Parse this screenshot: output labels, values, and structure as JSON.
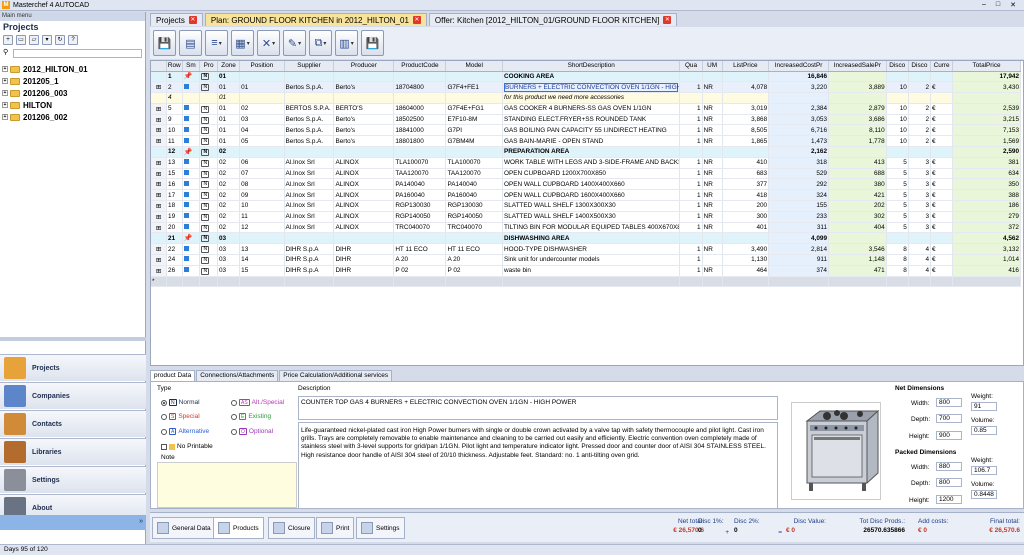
{
  "window": {
    "title": "Masterchef 4 AUTOCAD",
    "btn_min": "–",
    "btn_max": "□",
    "btn_close": "✕"
  },
  "sidebar": {
    "main_menu": "Main menu",
    "heading": "Projects",
    "tree": [
      "2012_HILTON_01",
      "201205_1",
      "201206_003",
      "HILTON",
      "201206_002"
    ],
    "nav": [
      {
        "label": "Projects",
        "icon": "projects-icon",
        "color": "#e8a23a"
      },
      {
        "label": "Companies",
        "icon": "companies-icon",
        "color": "#5c86c9"
      },
      {
        "label": "Contacts",
        "icon": "contacts-icon",
        "color": "#d08a38"
      },
      {
        "label": "Libraries",
        "icon": "libraries-icon",
        "color": "#b36b2e"
      },
      {
        "label": "Settings",
        "icon": "settings-icon",
        "color": "#8a8f99"
      },
      {
        "label": "About",
        "icon": "about-icon",
        "color": "#6a7383"
      }
    ]
  },
  "tabs": [
    {
      "label": "Projects",
      "active": false
    },
    {
      "label": "Plan: GROUND FLOOR KITCHEN in 2012_HILTON_01",
      "active": true
    },
    {
      "label": "Offer: Kitchen [2012_HILTON_01/GROUND FLOOR KITCHEN]",
      "active": false
    }
  ],
  "grid": {
    "columns": [
      "Row",
      "Sm",
      "Pro",
      "Zone",
      "Position",
      "Supplier",
      "Producer",
      "ProductCode",
      "Model",
      "ShortDescription",
      "Qua",
      "UM",
      "ListPrice",
      "IncreasedCostPr",
      "IncreasedSalePr",
      "Disco",
      "Disco",
      "Curre",
      "TotalPrice"
    ],
    "rows": [
      {
        "type": "section",
        "row": "1",
        "zone": "01",
        "desc": "COOKING AREA",
        "cost": "16,846",
        "total": "17,942"
      },
      {
        "type": "item",
        "selected": true,
        "row": "2",
        "zone": "01",
        "pos": "01",
        "sup": "Bertos S.p.A.",
        "prod": "Berto's",
        "code": "18704800",
        "model": "G7F4+FE1",
        "desc": "BURNERS + ELECTRIC CONVECTION OVEN 1/1GN - HIGH POWER",
        "qua": "1",
        "um": "NR",
        "list": "4,078",
        "cost": "3,220",
        "sale": "3,889",
        "d1": "10",
        "d2": "2",
        "cur": "€",
        "total": "3,430"
      },
      {
        "type": "note",
        "row": "4",
        "zone": "01",
        "desc": "for this product we need more accessories"
      },
      {
        "type": "item",
        "row": "5",
        "zone": "01",
        "pos": "02",
        "sup": "BERTOS S.P.A.",
        "prod": "BERTO'S",
        "code": "18604000",
        "model": "G7F4E+FG1",
        "desc": "GAS COOKER 4 BURNERS-SS GAS OVEN 1/1GN",
        "qua": "1",
        "um": "NR",
        "list": "3,019",
        "cost": "2,384",
        "sale": "2,879",
        "d1": "10",
        "d2": "2",
        "cur": "€",
        "total": "2,539"
      },
      {
        "type": "item",
        "row": "9",
        "zone": "01",
        "pos": "03",
        "sup": "Bertos S.p.A.",
        "prod": "Berto's",
        "code": "18502500",
        "model": "E7F10-8M",
        "desc": "STANDING ELECT.FRYER+SS ROUNDED TANK",
        "qua": "1",
        "um": "NR",
        "list": "3,868",
        "cost": "3,053",
        "sale": "3,686",
        "d1": "10",
        "d2": "2",
        "cur": "€",
        "total": "3,215"
      },
      {
        "type": "item",
        "row": "10",
        "zone": "01",
        "pos": "04",
        "sup": "Bertos S.p.A.",
        "prod": "Berto's",
        "code": "18841000",
        "model": "G7PI",
        "desc": "GAS BOILING PAN CAPACITY 55 I.INDIRECT HEATING",
        "qua": "1",
        "um": "NR",
        "list": "8,505",
        "cost": "6,716",
        "sale": "8,110",
        "d1": "10",
        "d2": "2",
        "cur": "€",
        "total": "7,153"
      },
      {
        "type": "item",
        "row": "11",
        "zone": "01",
        "pos": "05",
        "sup": "Bertos S.p.A.",
        "prod": "Berto's",
        "code": "18801800",
        "model": "G7BM4M",
        "desc": "GAS BAIN-MARIE - OPEN STAND",
        "qua": "1",
        "um": "NR",
        "list": "1,865",
        "cost": "1,473",
        "sale": "1,778",
        "d1": "10",
        "d2": "2",
        "cur": "€",
        "total": "1,569"
      },
      {
        "type": "section",
        "row": "12",
        "zone": "02",
        "desc": "PREPARATION AREA",
        "cost": "2,162",
        "total": "2,590"
      },
      {
        "type": "item",
        "row": "13",
        "zone": "02",
        "pos": "06",
        "sup": "Al.Inox Srl",
        "prod": "ALINOX",
        "code": "TLA100070",
        "model": "TLA100070",
        "desc": "WORK TABLE WITH LEGS AND 3-SIDE-FRAME AND BACKSPLASH",
        "qua": "1",
        "um": "NR",
        "list": "410",
        "cost": "318",
        "sale": "413",
        "d1": "5",
        "d2": "3",
        "cur": "€",
        "total": "381"
      },
      {
        "type": "item",
        "row": "15",
        "zone": "02",
        "pos": "07",
        "sup": "Al.Inox Srl",
        "prod": "ALINOX",
        "code": "TAA120070",
        "model": "TAA120070",
        "desc": "OPEN CUPBOARD  1200X700X850",
        "qua": "1",
        "um": "NR",
        "list": "683",
        "cost": "529",
        "sale": "688",
        "d1": "5",
        "d2": "3",
        "cur": "€",
        "total": "634"
      },
      {
        "type": "item",
        "row": "16",
        "zone": "02",
        "pos": "08",
        "sup": "Al.Inox Srl",
        "prod": "ALINOX",
        "code": "PA140040",
        "model": "PA140040",
        "desc": "OPEN WALL CUPBOARD 1400X400X660",
        "qua": "1",
        "um": "NR",
        "list": "377",
        "cost": "292",
        "sale": "380",
        "d1": "5",
        "d2": "3",
        "cur": "€",
        "total": "350"
      },
      {
        "type": "item",
        "row": "17",
        "zone": "02",
        "pos": "09",
        "sup": "Al.Inox Srl",
        "prod": "ALINOX",
        "code": "PA160040",
        "model": "PA160040",
        "desc": "OPEN WALL CUPBOARD 1600X400X660",
        "qua": "1",
        "um": "NR",
        "list": "418",
        "cost": "324",
        "sale": "421",
        "d1": "5",
        "d2": "3",
        "cur": "€",
        "total": "388"
      },
      {
        "type": "item",
        "row": "18",
        "zone": "02",
        "pos": "10",
        "sup": "Al.Inox Srl",
        "prod": "ALINOX",
        "code": "RGP130030",
        "model": "RGP130030",
        "desc": "SLATTED WALL SHELF  1300X300X30",
        "qua": "1",
        "um": "NR",
        "list": "200",
        "cost": "155",
        "sale": "202",
        "d1": "5",
        "d2": "3",
        "cur": "€",
        "total": "186"
      },
      {
        "type": "item",
        "row": "19",
        "zone": "02",
        "pos": "11",
        "sup": "Al.Inox Srl",
        "prod": "ALINOX",
        "code": "RGP140050",
        "model": "RGP140050",
        "desc": "SLATTED WALL SHELF  1400X500X30",
        "qua": "1",
        "um": "NR",
        "list": "300",
        "cost": "233",
        "sale": "302",
        "d1": "5",
        "d2": "3",
        "cur": "€",
        "total": "279"
      },
      {
        "type": "item",
        "row": "20",
        "zone": "02",
        "pos": "12",
        "sup": "Al.Inox Srl",
        "prod": "ALINOX",
        "code": "TRC040070",
        "model": "TRC040070",
        "desc": "TILTING BIN FOR MODULAR EQUIPED TABLES 400X670X810",
        "qua": "1",
        "um": "NR",
        "list": "401",
        "cost": "311",
        "sale": "404",
        "d1": "5",
        "d2": "3",
        "cur": "€",
        "total": "372"
      },
      {
        "type": "section",
        "row": "21",
        "zone": "03",
        "desc": "DISHWASHING AREA",
        "cost": "4,099",
        "total": "4,562"
      },
      {
        "type": "item",
        "row": "22",
        "zone": "03",
        "pos": "13",
        "sup": "DIHR S.p.A",
        "prod": "DIHR",
        "code": "HT 11 ECO",
        "model": "HT 11 ECO",
        "desc": "HOOD-TYPE DISHWASHER",
        "qua": "1",
        "um": "NR",
        "list": "3,490",
        "cost": "2,814",
        "sale": "3,546",
        "d1": "8",
        "d2": "4",
        "cur": "€",
        "total": "3,132"
      },
      {
        "type": "item",
        "row": "24",
        "zone": "03",
        "pos": "14",
        "sup": "DIHR S.p.A",
        "prod": "DIHR",
        "code": "A 20",
        "model": "A 20",
        "desc": "Sink unit for undercounter models",
        "qua": "1",
        "um": "",
        "list": "1,130",
        "cost": "911",
        "sale": "1,148",
        "d1": "8",
        "d2": "4",
        "cur": "€",
        "total": "1,014"
      },
      {
        "type": "item",
        "row": "26",
        "zone": "03",
        "pos": "15",
        "sup": "DIHR S.p.A",
        "prod": "DIHR",
        "code": "P 02",
        "model": "P 02",
        "desc": "waste bin",
        "qua": "1",
        "um": "NR",
        "list": "464",
        "cost": "374",
        "sale": "471",
        "d1": "8",
        "d2": "4",
        "cur": "€",
        "total": "416"
      }
    ]
  },
  "detail": {
    "tabs": [
      "product Data",
      "Connections/Attachments",
      "Price Calculation/Additional services"
    ],
    "type_label": "Type",
    "types": [
      {
        "badge": "N",
        "label": "Normal",
        "color": "#1d2d4d",
        "checked": true
      },
      {
        "badge": "AS",
        "label": "Alt./Special",
        "color": "#b23ab0",
        "checked": false
      },
      {
        "badge": "S",
        "label": "Special",
        "color": "#d43a2a",
        "checked": false
      },
      {
        "badge": "E",
        "label": "Existing",
        "color": "#2e9a3e",
        "checked": false
      },
      {
        "badge": "A",
        "label": "Alternative",
        "color": "#2b5bd1",
        "checked": false
      },
      {
        "badge": "O",
        "label": "Optional",
        "color": "#9a3ab8",
        "checked": false
      }
    ],
    "no_printable": "No Printable",
    "note_label": "Note",
    "desc_label": "Description",
    "desc_short": "COUNTER TOP GAS 4 BURNERS + ELECTRIC CONVECTION OVEN 1/1GN - HIGH POWER",
    "desc_long": "Life-guaranteed nickel-plated cast iron High Power burners with single or double crown activated by a valve tap with safety thermocouple and pilot light. Cast iron grills. Trays are completely removable to enable maintenance and cleaning to be carried out easily and efficiently. Electric convention oven completely made of stainless steel with 3-level supports for grid/pan 1/1GN. Pilot light and temperature indicator light. Pressed door and counter door of AISI 304 STAINLESS STEEL. High resistance door handle of AISI 304 steel of 20/10 thickness. Adjustable feet. Standard: no. 1 anti-tilting oven grid.",
    "net_dims_label": "Net Dimensions",
    "packed_dims_label": "Packed Dimensions",
    "width_label": "Width:",
    "depth_label": "Depth:",
    "height_label": "Height:",
    "weight_label": "Weight:",
    "volume_label": "Volume:",
    "net": {
      "width": "800",
      "depth": "700",
      "height": "900",
      "weight": "91",
      "volume": "0.85"
    },
    "packed": {
      "width": "880",
      "depth": "800",
      "height": "1200",
      "weight": "106.7",
      "volume": "0.8448"
    }
  },
  "bottom": {
    "buttons": [
      "General Data",
      "Products",
      "Closure",
      "Print",
      "Settings"
    ],
    "totals": [
      {
        "label": "Net total:",
        "value": "€ 26,570.6"
      },
      {
        "label": "Disc 1%:",
        "value": "0"
      },
      {
        "label": "Disc 2%:",
        "value": "0"
      },
      {
        "label": "Disc Value:",
        "value": "€ 0"
      },
      {
        "label": "Tot Disc Prods.:",
        "value": "26570.635866"
      },
      {
        "label": "Add costs:",
        "value": "€ 0"
      },
      {
        "label": "Final total:",
        "value": "€ 26,570.6"
      }
    ],
    "plus": "+",
    "equals": "="
  },
  "status": "Days 95 of 120"
}
